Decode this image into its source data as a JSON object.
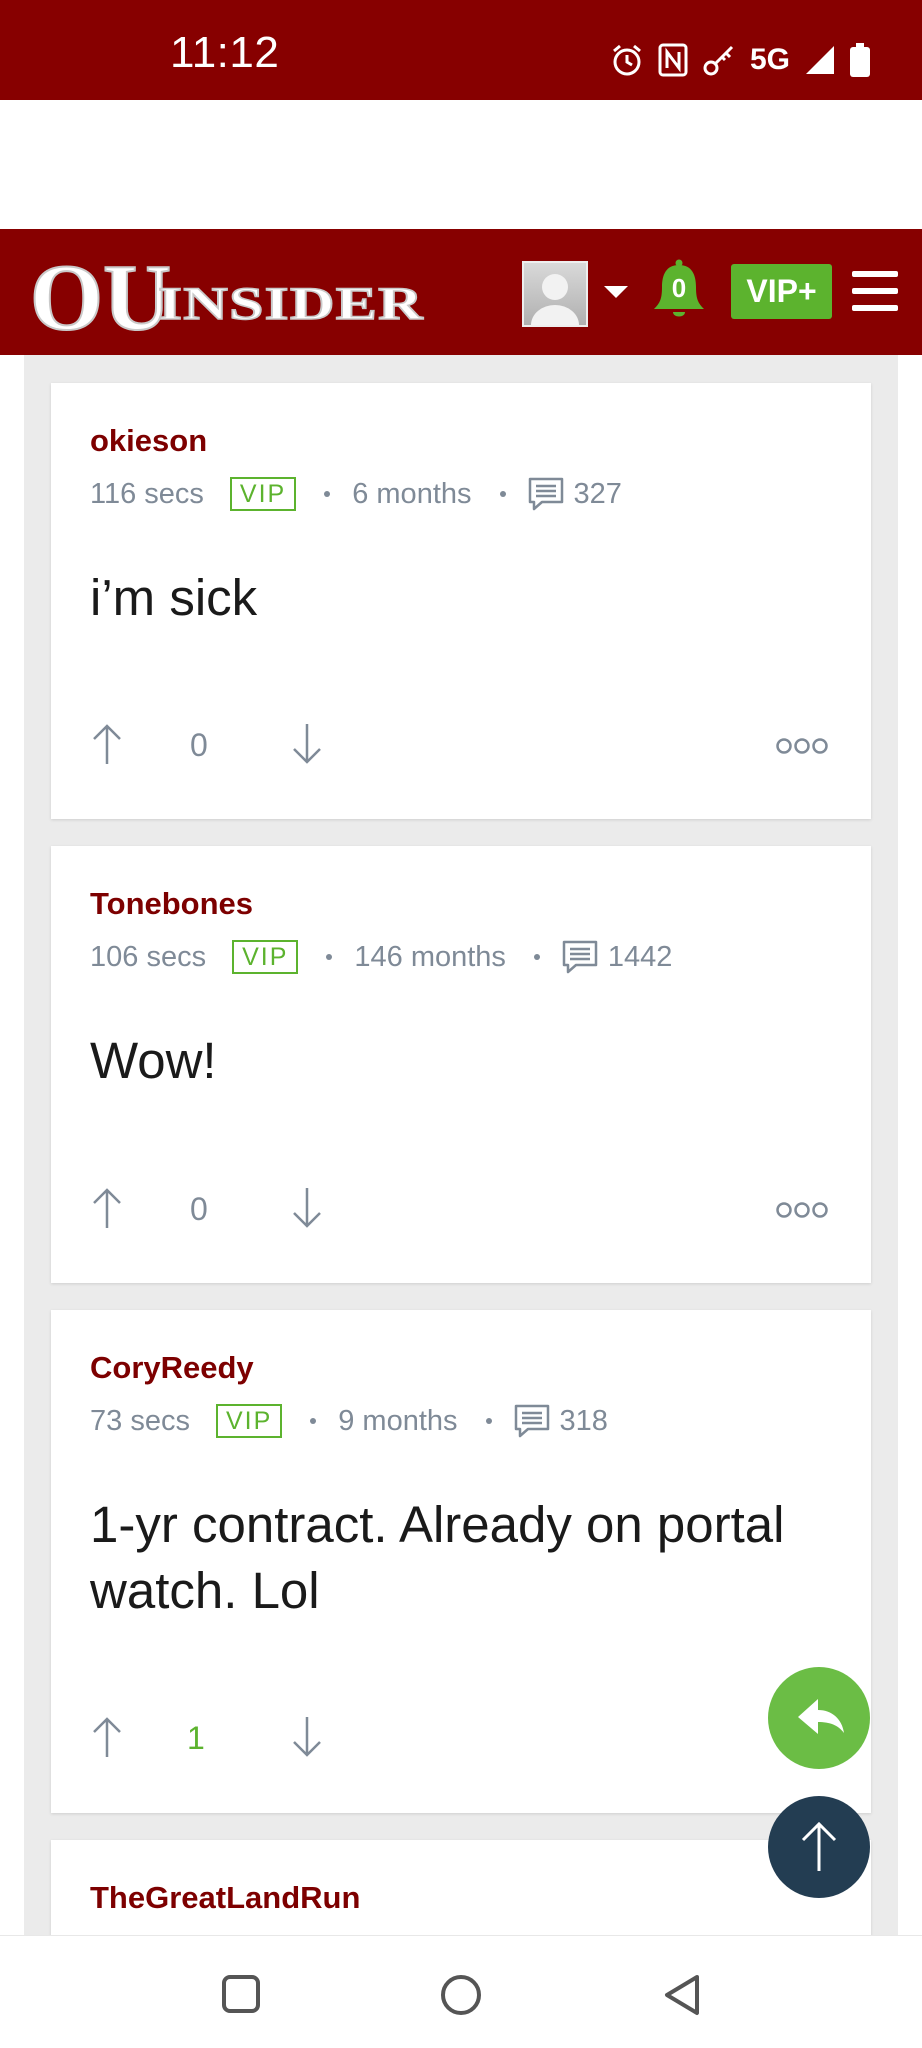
{
  "status_bar": {
    "time": "11:12",
    "network": "5G"
  },
  "header": {
    "logo_text_left": "OU",
    "logo_text_right": "INSIDER",
    "notification_count": "0",
    "vip_label": "VIP+"
  },
  "posts": [
    {
      "username": "okieson",
      "time": "116 secs",
      "badge": "VIP",
      "tenure": "6 months",
      "comments": "327",
      "text": "i’m sick",
      "votes": "0"
    },
    {
      "username": "Tonebones",
      "time": "106 secs",
      "badge": "VIP",
      "tenure": "146 months",
      "comments": "1442",
      "text": "Wow!",
      "votes": "0"
    },
    {
      "username": "CoryReedy",
      "time": "73 secs",
      "badge": "VIP",
      "tenure": "9 months",
      "comments": "318",
      "text": "1-yr contract. Already on portal watch. Lol",
      "votes": "1"
    },
    {
      "username": "TheGreatLandRun"
    }
  ],
  "colors": {
    "brand": "#870000",
    "accent_green": "#5cb32e",
    "username": "#7d0000",
    "meta_gray": "#7f8a97",
    "scroll_top": "#233d52"
  },
  "icons": [
    "alarm-icon",
    "nfc-icon",
    "key-icon",
    "signal-icon",
    "battery-icon",
    "avatar",
    "bell-icon",
    "menu-icon",
    "comment-icon",
    "arrow-up-icon",
    "arrow-down-icon",
    "more-icon",
    "reply-icon",
    "nav-recents-icon",
    "nav-home-icon",
    "nav-back-icon"
  ]
}
